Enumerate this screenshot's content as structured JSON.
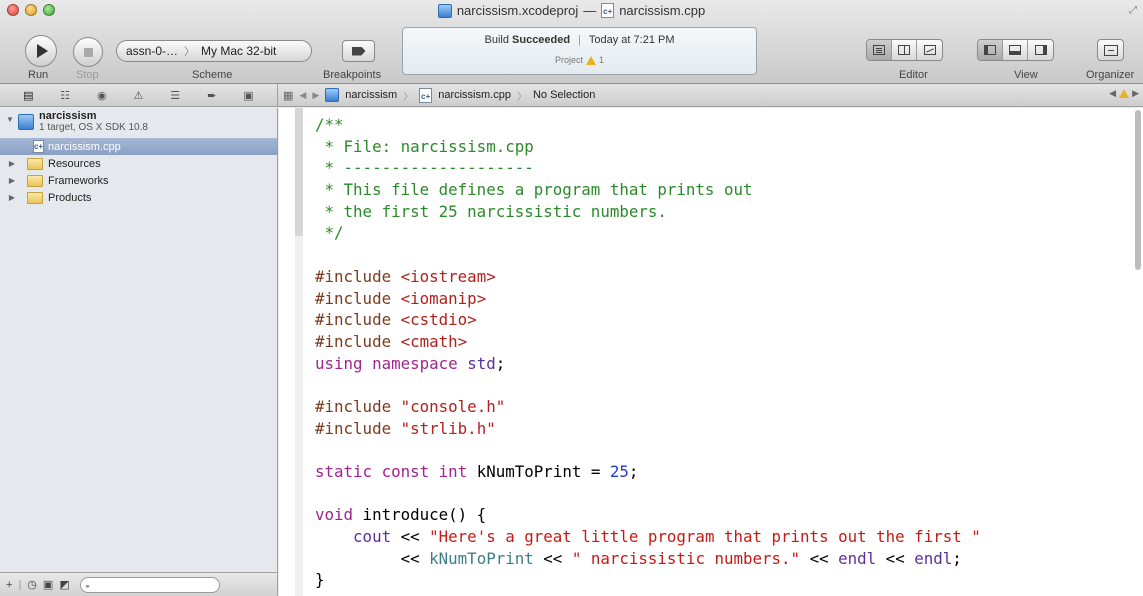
{
  "window": {
    "title_project": "narcissism.xcodeproj",
    "title_sep": "—",
    "title_file": "narcissism.cpp"
  },
  "toolbar": {
    "run_label": "Run",
    "stop_label": "Stop",
    "scheme_target": "assn-0-…",
    "scheme_destination": "My Mac 32-bit",
    "scheme_label": "Scheme",
    "breakpoints_label": "Breakpoints",
    "editor_label": "Editor",
    "view_label": "View",
    "organizer_label": "Organizer"
  },
  "activity": {
    "status_prefix": "Build",
    "status_bold": "Succeeded",
    "status_time": "Today at 7:21 PM",
    "project_label": "Project",
    "warning_count": "1"
  },
  "jumpbar": {
    "items": [
      "narcissism",
      "narcissism.cpp",
      "No Selection"
    ]
  },
  "navigator": {
    "project": {
      "name": "narcissism",
      "subtitle": "1 target, OS X SDK 10.8"
    },
    "items": [
      {
        "label": "narcissism.cpp",
        "kind": "file",
        "selected": true
      },
      {
        "label": "Resources",
        "kind": "folder"
      },
      {
        "label": "Frameworks",
        "kind": "folder"
      },
      {
        "label": "Products",
        "kind": "folder"
      }
    ]
  },
  "code": {
    "lines": [
      "/**",
      " * File: narcissism.cpp",
      " * --------------------",
      " * This file defines a program that prints out",
      " * the first 25 narcissistic numbers.",
      " */",
      "",
      "#include <iostream>",
      "#include <iomanip>",
      "#include <cstdio>",
      "#include <cmath>",
      "using namespace std;",
      "",
      "#include \"console.h\"",
      "#include \"strlib.h\"",
      "",
      "static const int kNumToPrint = 25;",
      "",
      "void introduce() {",
      "    cout << \"Here's a great little program that prints out the first \"",
      "         << kNumToPrint << \" narcissistic numbers.\" << endl << endl;",
      "}"
    ]
  },
  "colors": {
    "comment": "#2a8a2a",
    "preprocessor": "#7a3b1f",
    "string": "#c41a16",
    "keyword": "#a2228f",
    "number": "#2837d1",
    "identifier": "#3d7e86",
    "selection": "#8aa0c4"
  }
}
